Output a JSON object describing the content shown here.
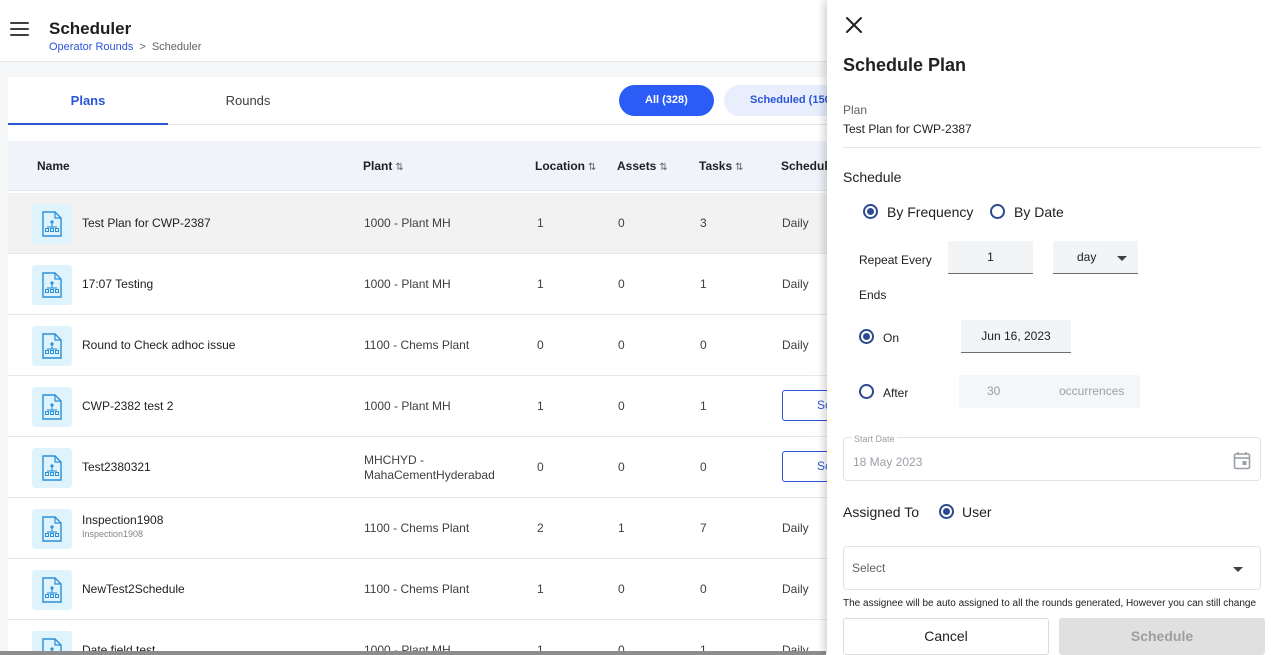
{
  "header": {
    "title": "Scheduler",
    "breadcrumb": [
      "Operator Rounds",
      "Scheduler"
    ],
    "breadcrumb_sep": ">"
  },
  "tabs": [
    {
      "label": "Plans",
      "active": true
    },
    {
      "label": "Rounds",
      "active": false
    }
  ],
  "filters": {
    "all": "All (328)",
    "scheduled": "Scheduled (150"
  },
  "table": {
    "columns": {
      "name": "Name",
      "plant": "Plant",
      "location": "Location",
      "assets": "Assets",
      "tasks": "Tasks",
      "schedule": "Schedule"
    },
    "rows": [
      {
        "name": "Test Plan for CWP-2387",
        "sub": "",
        "plant": "1000 - Plant MH",
        "plant2": "",
        "location": "1",
        "assets": "0",
        "tasks": "3",
        "schedule": "Daily",
        "button": "",
        "selected": true
      },
      {
        "name": "17:07 Testing",
        "sub": "",
        "plant": "1000 - Plant MH",
        "plant2": "",
        "location": "1",
        "assets": "0",
        "tasks": "1",
        "schedule": "Daily",
        "button": "",
        "selected": false
      },
      {
        "name": "Round to Check adhoc issue",
        "sub": "",
        "plant": "1100 - Chems Plant",
        "plant2": "",
        "location": "0",
        "assets": "0",
        "tasks": "0",
        "schedule": "Daily",
        "button": "",
        "selected": false
      },
      {
        "name": "CWP-2382 test 2",
        "sub": "",
        "plant": "1000 - Plant MH",
        "plant2": "",
        "location": "1",
        "assets": "0",
        "tasks": "1",
        "schedule": "",
        "button": "Sc",
        "selected": false
      },
      {
        "name": "Test2380321",
        "sub": "",
        "plant": "MHCHYD -",
        "plant2": "MahaCementHyderabad",
        "location": "0",
        "assets": "0",
        "tasks": "0",
        "schedule": "",
        "button": "Sc",
        "selected": false
      },
      {
        "name": "Inspection1908",
        "sub": "Inspection1908",
        "plant": "1100 - Chems Plant",
        "plant2": "",
        "location": "2",
        "assets": "1",
        "tasks": "7",
        "schedule": "Daily",
        "button": "",
        "selected": false
      },
      {
        "name": "NewTest2Schedule",
        "sub": "",
        "plant": "1100 - Chems Plant",
        "plant2": "",
        "location": "1",
        "assets": "0",
        "tasks": "0",
        "schedule": "Daily",
        "button": "",
        "selected": false
      },
      {
        "name": "Date field test",
        "sub": "",
        "plant": "1000 - Plant MH",
        "plant2": "",
        "location": "1",
        "assets": "0",
        "tasks": "1",
        "schedule": "Daily",
        "button": "",
        "selected": false
      }
    ]
  },
  "panel": {
    "title": "Schedule Plan",
    "plan_label": "Plan",
    "plan_value": "Test Plan for CWP-2387",
    "schedule_label": "Schedule",
    "by_frequency": "By Frequency",
    "by_date": "By Date",
    "repeat_every_label": "Repeat Every",
    "repeat_value": "1",
    "repeat_unit": "day",
    "ends_label": "Ends",
    "on_label": "On",
    "on_date": "Jun 16, 2023",
    "after_label": "After",
    "after_value": "30",
    "occurrences_label": "occurrences",
    "start_date_label": "Start Date",
    "start_date_value": "18 May 2023",
    "assigned_to_label": "Assigned To",
    "user_label": "User",
    "select_placeholder": "Select",
    "helper_text": "The assignee will be auto assigned to all the rounds generated, However you can still change",
    "cancel_label": "Cancel",
    "schedule_button": "Schedule"
  },
  "colors": {
    "primary": "#2c55d6",
    "pill_active": "#2c5cf6",
    "radio": "#2c4a8f",
    "row_icon_bg": "#dff3fc"
  }
}
